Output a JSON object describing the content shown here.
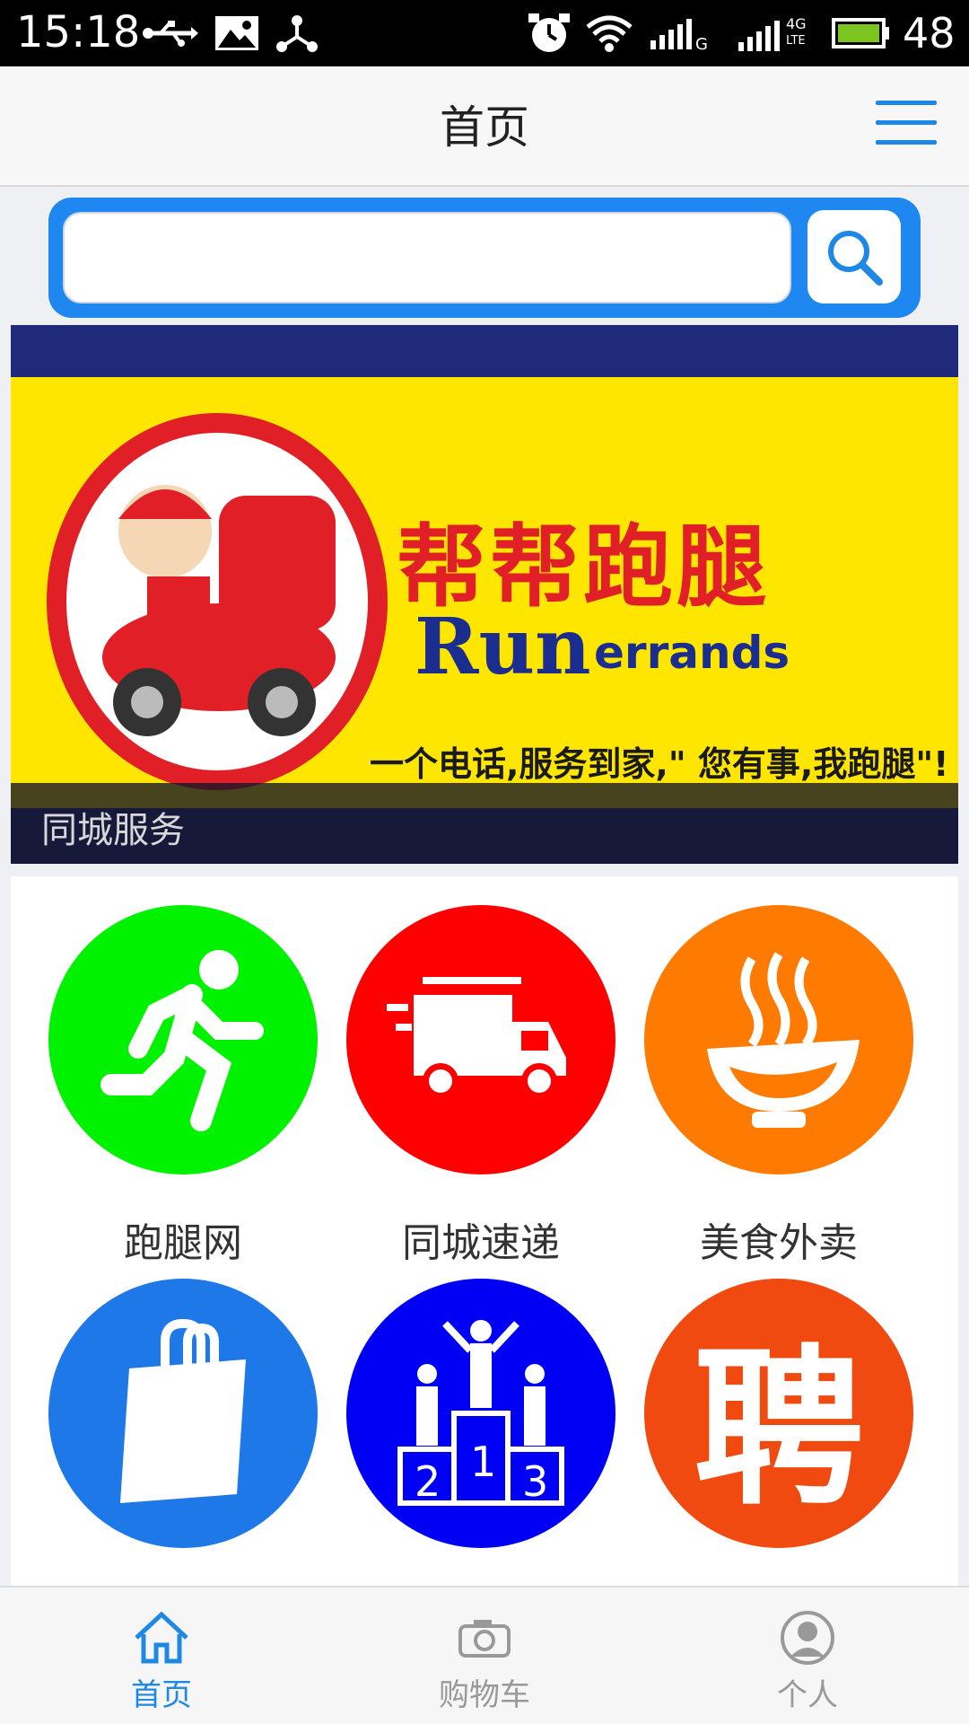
{
  "status_bar": {
    "time": "15:18",
    "battery": "48",
    "network_label": "4G",
    "lte_label": "LTE"
  },
  "header": {
    "title": "首页"
  },
  "search": {
    "placeholder": ""
  },
  "banner": {
    "brand_cn": "帮帮跑腿",
    "brand_run": "Run",
    "brand_errands": "errands",
    "slogan": "一个电话,服务到家,\" 您有事,我跑腿\"!",
    "caption": "同城服务"
  },
  "services": [
    {
      "label": "跑腿网",
      "icon": "running-man-icon",
      "color": "#00f200"
    },
    {
      "label": "同城速递",
      "icon": "delivery-truck-icon",
      "color": "#ff0000"
    },
    {
      "label": "美食外卖",
      "icon": "food-bowl-icon",
      "color": "#ff7a00"
    },
    {
      "label": "",
      "icon": "shopping-bag-icon",
      "color": "#1e78e8"
    },
    {
      "label": "",
      "icon": "podium-icon",
      "color": "#0000f5"
    },
    {
      "label": "",
      "icon": "recruit-icon",
      "color": "#f04a10",
      "glyph": "聘"
    }
  ],
  "tabbar": {
    "items": [
      {
        "label": "首页",
        "icon": "home-icon",
        "active": true
      },
      {
        "label": "购物车",
        "icon": "camera-icon",
        "active": false
      },
      {
        "label": "个人",
        "icon": "user-icon",
        "active": false
      }
    ],
    "active_color": "#1e88e5",
    "inactive_color": "#999999"
  }
}
